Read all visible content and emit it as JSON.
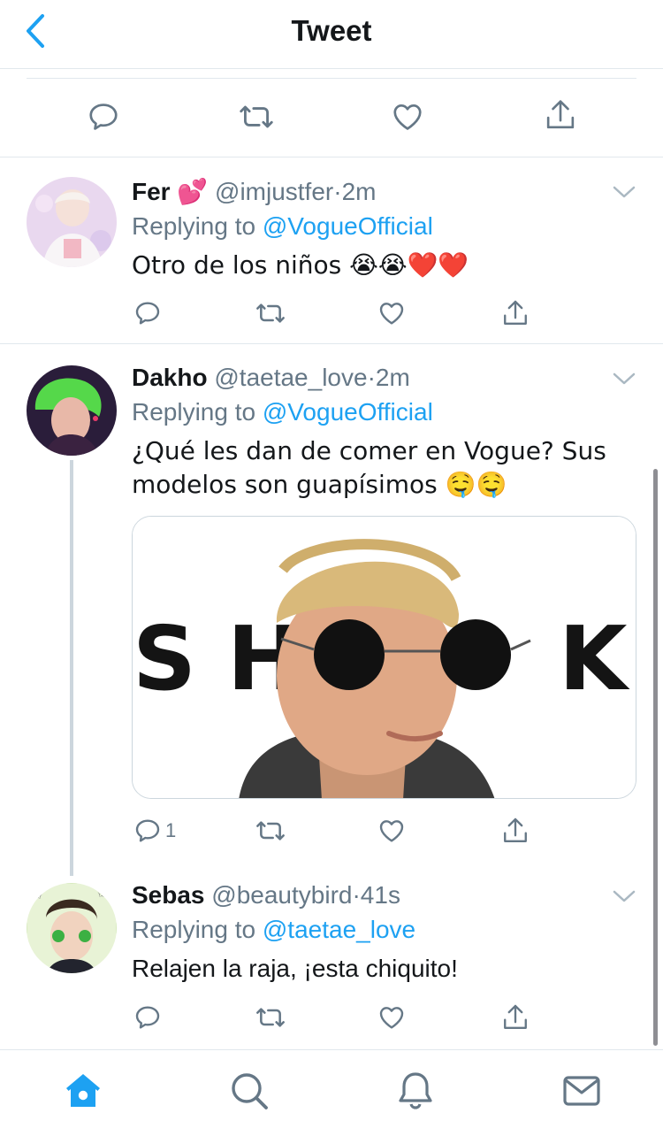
{
  "header": {
    "title": "Tweet"
  },
  "replies": [
    {
      "name": "Fer",
      "name_emoji": "💕",
      "handle": "@imjustfer",
      "dot": "·",
      "time": "2m",
      "replying_prefix": "Replying to",
      "replying_to": "@VogueOfficial",
      "text": "Otro de los niños 😭😭❤️❤️"
    },
    {
      "name": "Dakho",
      "handle": "@taetae_love",
      "dot": "·",
      "time": "2m",
      "replying_prefix": "Replying to",
      "replying_to": "@VogueOfficial",
      "text": "¿Qué les dan de comer en Vogue? Sus modelos son guapísimos 🤤🤤",
      "media_text_left": "S H",
      "media_text_right": "K",
      "reply_count": "1"
    },
    {
      "name": "Sebas",
      "handle": "@beautybird",
      "dot": "·",
      "time": "41s",
      "replying_prefix": "Replying to",
      "replying_to": "@taetae_love",
      "text": "Relajen la raja, ¡esta chiquito!"
    }
  ],
  "colors": {
    "accent": "#1da1f2",
    "secondary": "#657786",
    "border": "#e1e8ed"
  },
  "icons": [
    "back-chevron-icon",
    "reply-icon",
    "retweet-icon",
    "like-icon",
    "share-icon",
    "home-icon",
    "search-icon",
    "notifications-icon",
    "messages-icon"
  ]
}
